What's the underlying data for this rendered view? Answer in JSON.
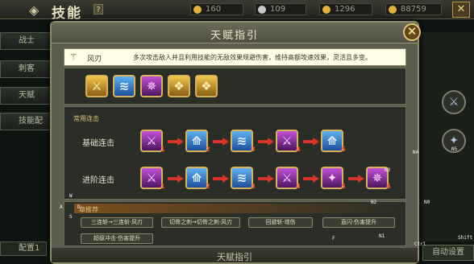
{
  "hud": {
    "back_arrow": "◈",
    "title": "技能",
    "help": "?",
    "currency": [
      {
        "value": "160",
        "color": "#e0b43a",
        "icon": "gold-coin-icon"
      },
      {
        "value": "109",
        "color": "#c8c8c8",
        "icon": "silver-coin-icon"
      },
      {
        "value": "1296",
        "color": "#e0b43a",
        "icon": "gold-coin-icon"
      },
      {
        "value": "88759",
        "color": "#e0b43a",
        "icon": "gold-coin-icon"
      }
    ],
    "close": "✕",
    "side_tabs": [
      "战士",
      "刺客",
      "天赋",
      "技能配"
    ],
    "config": "配置1",
    "auto_fight": "自动设置",
    "debug_labels": [
      "W",
      "A",
      "D",
      "S",
      "N2",
      "N0",
      "N4",
      "N5",
      "N3",
      "N1",
      "F",
      "Shift",
      "Ctrl"
    ]
  },
  "dialog": {
    "title": "天赋指引",
    "close": "✕",
    "weapon": {
      "name": "风刃",
      "icon": "wind-blade-icon",
      "description": "多次攻击敌人并且利用技能的无敌效果规避伤害，维持高额攻速效果，灵活且多变。"
    },
    "talent_icons": [
      {
        "glyph": "⚔",
        "style": "gold",
        "icon": "talent-gold-slash-icon"
      },
      {
        "glyph": "≋",
        "style": "blue",
        "icon": "talent-blue-wave-icon"
      },
      {
        "glyph": "✵",
        "style": "pink",
        "icon": "talent-pink-star-icon"
      },
      {
        "glyph": "❖",
        "style": "gold",
        "icon": "talent-gold-scroll-icon"
      },
      {
        "glyph": "❖",
        "style": "gold",
        "icon": "talent-gold-scroll2-icon"
      }
    ],
    "combo_section": "常用连击",
    "basic_combo": {
      "label": "基础连击",
      "steps": [
        {
          "num": "1",
          "glyph": "⚔",
          "style": "pink"
        },
        {
          "num": "2",
          "glyph": "⟰",
          "style": "blue"
        },
        {
          "num": "3",
          "glyph": "≋",
          "style": "blue"
        },
        {
          "num": "4",
          "glyph": "⚔",
          "style": "pink"
        },
        {
          "num": "5",
          "glyph": "⟰",
          "style": "blue"
        }
      ]
    },
    "advanced_combo": {
      "label": "进阶连击",
      "steps": [
        {
          "num": "1",
          "glyph": "⚔",
          "style": "pink"
        },
        {
          "num": "2",
          "glyph": "⟰",
          "style": "blue"
        },
        {
          "num": "3",
          "glyph": "≋",
          "style": "blue"
        },
        {
          "num": "4",
          "glyph": "⚔",
          "style": "pink"
        },
        {
          "num": "5",
          "glyph": "✦",
          "style": "pink"
        },
        {
          "num": "6",
          "glyph": "✵",
          "style": "pink"
        }
      ]
    },
    "recommend_section": "章推荐",
    "recommendations": [
      "三连斩→三连斩·风刃",
      "切骨之刺→切骨之刺·风刃",
      "回避斩·增伤",
      "直闪·伤害提升",
      "超级冲击·伤害提升"
    ],
    "bottom_caption": "天赋指引"
  }
}
